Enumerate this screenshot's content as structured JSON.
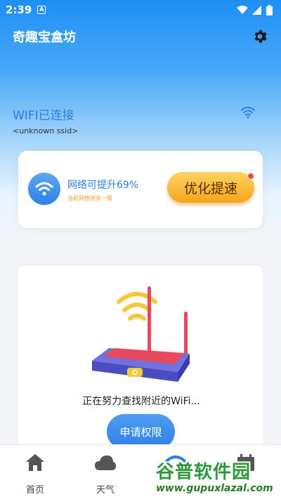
{
  "status_bar": {
    "time": "2:39",
    "notification_icon": "A",
    "icons": [
      "wifi-icon",
      "signal-icon",
      "battery-icon"
    ]
  },
  "app_bar": {
    "title": "奇趣宝盒坊",
    "settings_icon": "gear-icon"
  },
  "wifi": {
    "status": "WIFI已连接",
    "ssid": "<unknown ssid>"
  },
  "boost_card": {
    "title": "网络可提升69%",
    "subtitle": "当前网络状态一般",
    "button_label": "优化提速"
  },
  "scan_card": {
    "message": "正在努力查找附近的WiFi...",
    "button_label": "申请权限"
  },
  "bottom_nav": {
    "items": [
      {
        "label": "首页",
        "icon": "home-icon"
      },
      {
        "label": "天气",
        "icon": "cloud-icon"
      },
      {
        "label": "",
        "icon": "wifi-icon"
      },
      {
        "label": "",
        "icon": "calendar-icon"
      }
    ]
  },
  "watermark": {
    "title": "谷普软件园",
    "url": "www.gupuxlazal.com"
  },
  "colors": {
    "primary": "#2f7fe6",
    "accent": "#f6a41c",
    "header_top": "#1e8ff5"
  }
}
